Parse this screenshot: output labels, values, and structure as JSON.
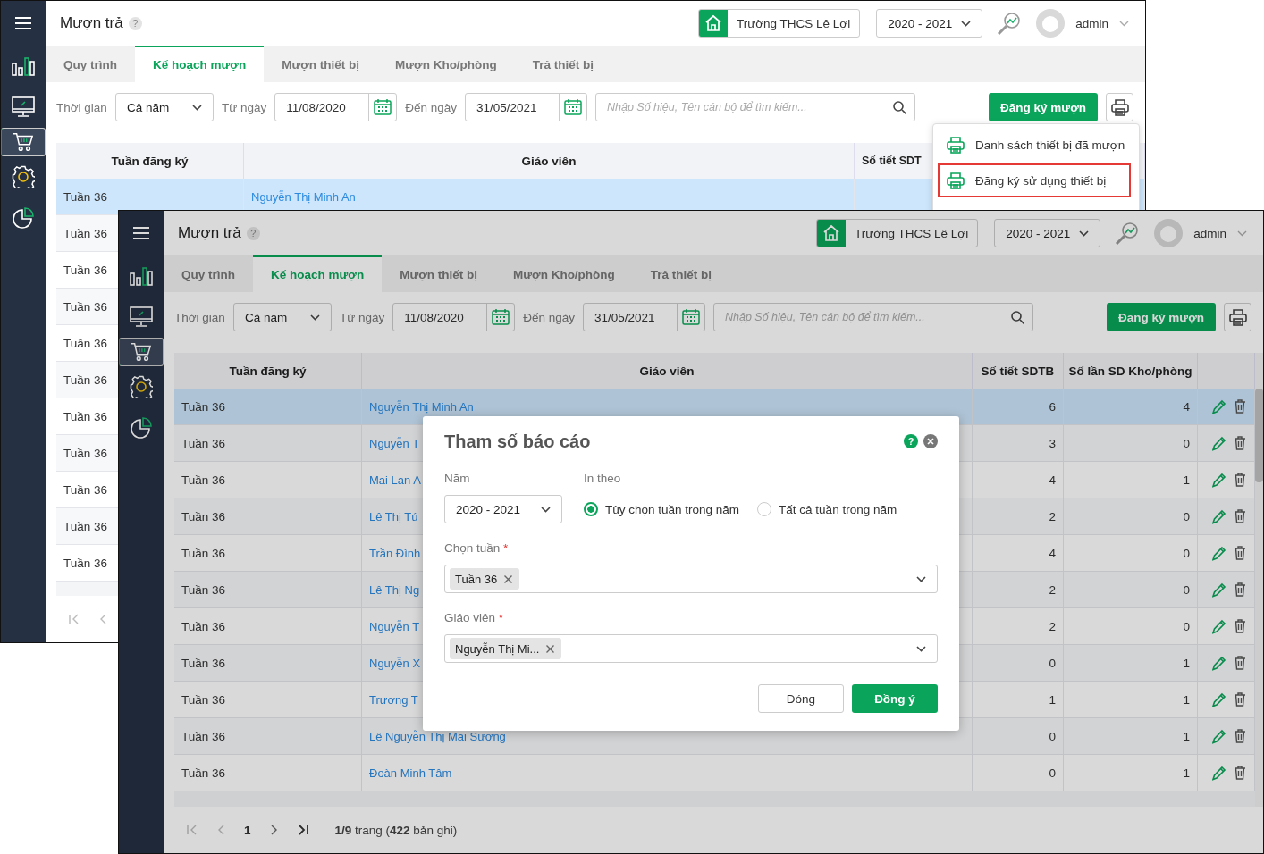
{
  "windows": [
    {
      "kind": "back",
      "title": "Mượn trả",
      "help": "?",
      "school": "Trường THCS Lê Lợi",
      "year": "2020 - 2021",
      "user": "admin",
      "sidebar": [
        {
          "kind": "chart",
          "selected": false
        },
        {
          "kind": "monitor",
          "selected": false
        },
        {
          "kind": "cart",
          "selected": true
        },
        {
          "kind": "gear",
          "selected": false
        },
        {
          "kind": "pie",
          "selected": false
        }
      ],
      "tabs": [
        {
          "label": "Quy trình",
          "selected": false
        },
        {
          "label": "Kế hoạch mượn",
          "selected": true
        },
        {
          "label": "Mượn thiết bị",
          "selected": false
        },
        {
          "label": "Mượn Kho/phòng",
          "selected": false
        },
        {
          "label": "Trả thiết bị",
          "selected": false
        }
      ],
      "filters": {
        "period_label": "Thời gian",
        "period": "Cả năm",
        "from_label": "Từ ngày",
        "from": "11/08/2020",
        "to_label": "Đến ngày",
        "to": "31/05/2021",
        "search_placeholder": "Nhập Số hiệu, Tên cán bộ để tìm kiếm...",
        "register_button": "Đăng ký mượn"
      },
      "table": {
        "columns": [
          "Tuần đăng ký",
          "Giáo viên",
          "Số tiết SDT"
        ],
        "rows": [
          {
            "week": "Tuần 36",
            "teacher": "Nguyễn Thị Minh An",
            "selected": true
          },
          {
            "week": "Tuần 36",
            "selected": false
          },
          {
            "week": "Tuần 36",
            "selected": false
          },
          {
            "week": "Tuần 36",
            "selected": false
          },
          {
            "week": "Tuần 36",
            "selected": false
          },
          {
            "week": "Tuần 36",
            "selected": false
          },
          {
            "week": "Tuần 36",
            "selected": false
          },
          {
            "week": "Tuần 36",
            "selected": false
          },
          {
            "week": "Tuần 36",
            "selected": false
          },
          {
            "week": "Tuần 36",
            "selected": false
          },
          {
            "week": "Tuần 36",
            "selected": false
          }
        ]
      },
      "menu": [
        {
          "label": "Danh sách thiết bị đã mượn",
          "highlighted": false
        },
        {
          "label": "Đăng ký sử dụng thiết bị",
          "highlighted": true
        }
      ]
    },
    {
      "kind": "front",
      "title": "Mượn trả",
      "help": "?",
      "school": "Trường THCS Lê Lợi",
      "year": "2020 - 2021",
      "user": "admin",
      "sidebar": [
        {
          "kind": "chart",
          "selected": false
        },
        {
          "kind": "monitor",
          "selected": false
        },
        {
          "kind": "cart",
          "selected": true
        },
        {
          "kind": "gear",
          "selected": false
        },
        {
          "kind": "pie",
          "selected": false
        }
      ],
      "tabs": [
        {
          "label": "Quy trình",
          "selected": false
        },
        {
          "label": "Kế hoạch mượn",
          "selected": true
        },
        {
          "label": "Mượn thiết bị",
          "selected": false
        },
        {
          "label": "Mượn Kho/phòng",
          "selected": false
        },
        {
          "label": "Trả thiết bị",
          "selected": false
        }
      ],
      "filters": {
        "period_label": "Thời gian",
        "period": "Cả năm",
        "from_label": "Từ ngày",
        "from": "11/08/2020",
        "to_label": "Đến ngày",
        "to": "31/05/2021",
        "search_placeholder": "Nhập Số hiệu, Tên cán bộ để tìm kiếm...",
        "register_button": "Đăng ký mượn"
      },
      "table": {
        "columns": [
          "Tuần đăng ký",
          "Giáo viên",
          "Số tiết SDTB",
          "Số lần SD Kho/phòng"
        ],
        "rows": [
          {
            "week": "Tuần 36",
            "teacher": "Nguyễn Thị Minh An",
            "sdtb": "6",
            "room": "4",
            "selected": true
          },
          {
            "week": "Tuần 36",
            "teacher": "Nguyễn T",
            "sdtb": "3",
            "room": "0",
            "selected": false
          },
          {
            "week": "Tuần 36",
            "teacher": "Mai Lan A",
            "sdtb": "4",
            "room": "1",
            "selected": false
          },
          {
            "week": "Tuần 36",
            "teacher": "Lê Thị Tú",
            "sdtb": "2",
            "room": "0",
            "selected": false
          },
          {
            "week": "Tuần 36",
            "teacher": "Trần Đình",
            "sdtb": "4",
            "room": "0",
            "selected": false
          },
          {
            "week": "Tuần 36",
            "teacher": "Lê Thị Ng",
            "sdtb": "2",
            "room": "0",
            "selected": false
          },
          {
            "week": "Tuần 36",
            "teacher": "Nguyễn T",
            "sdtb": "2",
            "room": "0",
            "selected": false
          },
          {
            "week": "Tuần 36",
            "teacher": "Nguyễn X",
            "sdtb": "0",
            "room": "1",
            "selected": false
          },
          {
            "week": "Tuần 36",
            "teacher": "Trương T",
            "sdtb": "1",
            "room": "1",
            "selected": false
          },
          {
            "week": "Tuần 36",
            "teacher": "Lê Nguyễn Thị Mai Sương",
            "sdtb": "0",
            "room": "1",
            "selected": false
          },
          {
            "week": "Tuần 36",
            "teacher": "Đoàn Minh Tâm",
            "sdtb": "0",
            "room": "1",
            "selected": false
          }
        ]
      },
      "pagination": {
        "page": "1",
        "summary": "**1/9** trang (**422** bản ghi)"
      },
      "dialog": {
        "title": "Tham số báo cáo",
        "help": "?",
        "year_label": "Năm",
        "year": "2020 - 2021",
        "print_label": "In theo",
        "print_options": [
          {
            "label": "Tùy chọn tuần trong năm",
            "selected": true
          },
          {
            "label": "Tất cả tuần trong năm",
            "selected": false
          }
        ],
        "fields": [
          {
            "label": "Chọn tuần",
            "required": "*",
            "tags": [
              "Tuần 36"
            ]
          },
          {
            "label": "Giáo viên",
            "required": "*",
            "tags": [
              "Nguyễn Thị Mi..."
            ]
          }
        ],
        "buttons": [
          {
            "label": "Đóng",
            "kind": "secondary"
          },
          {
            "label": "Đồng ý",
            "kind": "primary"
          }
        ]
      }
    }
  ]
}
